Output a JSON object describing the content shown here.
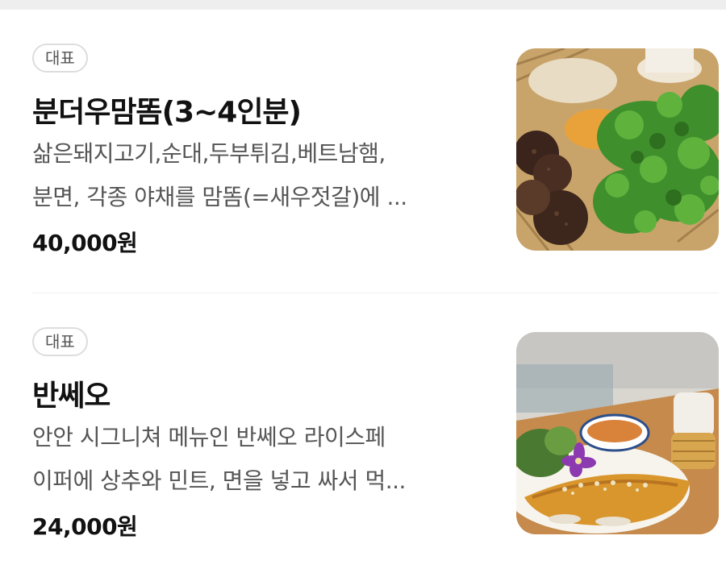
{
  "menu": {
    "items": [
      {
        "badge": "대표",
        "title": "분더우맘똠(3~4인분)",
        "desc_line1": "삶은돼지고기,순대,두부튀김,베트남햄,",
        "desc_line2": "분면, 각종 야채를 맘똠(=새우젓갈)에 ...",
        "price": "40,000원",
        "image": "bun-dau-mam-tom-platter-photo"
      },
      {
        "badge": "대표",
        "title": "반쎄오",
        "desc_line1": "안안 시그니쳐 메뉴인 반쎄오 라이스페",
        "desc_line2": "이퍼에 상추와 민트, 면을 넣고 싸서 먹...",
        "price": "24,000원",
        "image": "banh-xeo-photo"
      }
    ]
  }
}
